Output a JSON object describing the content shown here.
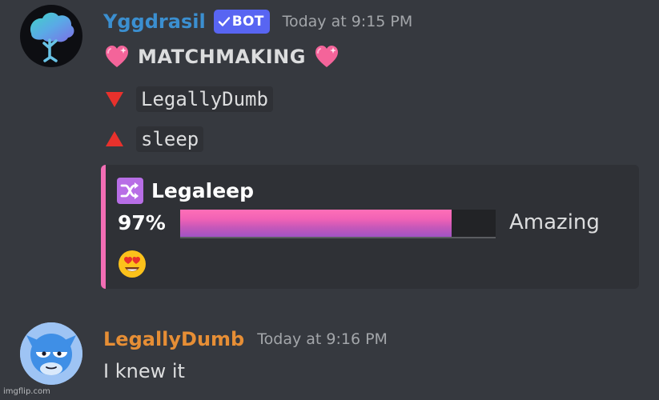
{
  "messages": [
    {
      "username": "Yggdrasil",
      "username_color": "#3b8fd0",
      "bot_tag": "BOT",
      "timestamp": "Today at 9:15 PM",
      "title": "MATCHMAKING",
      "user_down": "LegallyDumb",
      "user_up": "sleep",
      "embed": {
        "title": "Legaleep",
        "percent_text": "97%",
        "progress": 0.86,
        "rating": "Amazing",
        "reaction_icon": "heart-eyes-emoji-icon"
      }
    },
    {
      "username": "LegallyDumb",
      "username_color": "#e68e35",
      "timestamp": "Today at 9:16 PM",
      "text": "I knew it"
    }
  ],
  "watermark": "imgflip.com",
  "colors": {
    "background": "#36393f",
    "embed_background": "#2f3136",
    "embed_accent": "#f26eb4",
    "bot_tag": "#5865f2"
  }
}
